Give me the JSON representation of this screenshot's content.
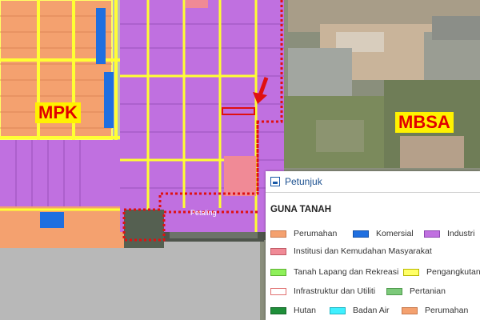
{
  "map": {
    "labels": {
      "left": "MPK",
      "right": "MBSA",
      "road": "Petaling"
    }
  },
  "legend": {
    "title": "Petunjuk",
    "section_title": "GUNA TANAH",
    "items": [
      {
        "label": "Perumahan",
        "color": "#f4a16f",
        "border": "#c87a4e"
      },
      {
        "label": "Komersial",
        "color": "#1f6fe0",
        "border": "#1552a8"
      },
      {
        "label": "Industri",
        "color": "#c070e0",
        "border": "#8d48b0"
      },
      {
        "label": "Institusi dan Kemudahan Masyarakat",
        "color": "#f08a96",
        "border": "#c05a66"
      },
      {
        "label": "Tanah Lapang dan Rekreasi",
        "color": "#8ef05a",
        "border": "#5fb233"
      },
      {
        "label": "Pengangkutan",
        "color": "#ffff66",
        "border": "#b8b800"
      },
      {
        "label": "Infrastruktur dan Utiliti",
        "color": "#ffffff",
        "border": "#e07070"
      },
      {
        "label": "Pertanian",
        "color": "#7cc97a",
        "border": "#4f9a4d"
      },
      {
        "label": "Hutan",
        "color": "#1f8f3a",
        "border": "#146628"
      },
      {
        "label": "Badan Air",
        "color": "#3ff0ff",
        "border": "#20b6c4"
      },
      {
        "label": "Perumahan",
        "color": "#f4a16f",
        "border": "#c87a4e"
      }
    ]
  }
}
